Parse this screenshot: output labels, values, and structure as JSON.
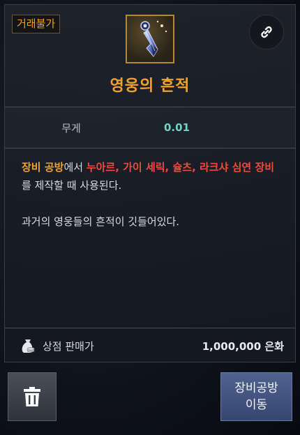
{
  "tooltip": {
    "trade_badge": "거래불가",
    "item_name": "영웅의 흔적",
    "item_icon": "crystal-hammer-icon",
    "link_icon": "link-icon",
    "stats": {
      "weight_label": "무게",
      "weight_value": "0.01"
    },
    "description": {
      "part1": "장비 공방",
      "part2": "에서 ",
      "part3": "누아르, 가이 세릭, 슐츠, 라크샤 심연 장비",
      "part4": "를 제작할 때 사용된다.",
      "flavor": "과거의 영웅들의 흔적이 깃들어있다."
    },
    "sell": {
      "icon": "coin-bag-icon",
      "label": "상점 판매가",
      "price": "1,000,000 은화"
    }
  },
  "buttons": {
    "delete_icon": "trash-icon",
    "move_line1": "장비공방",
    "move_line2": "이동"
  },
  "colors": {
    "orange": "#f2a22a",
    "red": "#f04a3a",
    "teal": "#6fd4c4",
    "button_blue": "#4f6290"
  }
}
